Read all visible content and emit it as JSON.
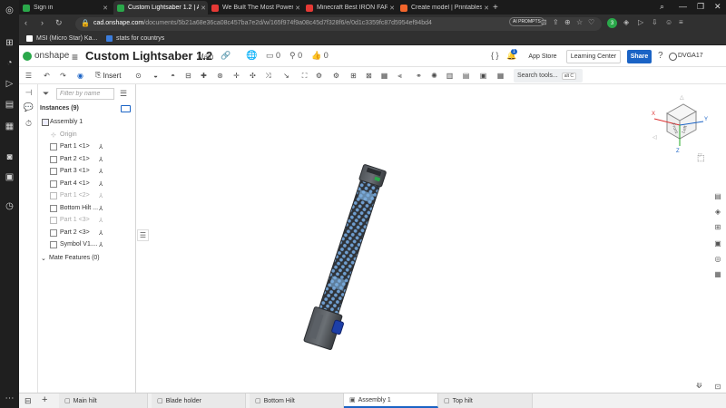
{
  "browser": {
    "tabs": [
      {
        "label": "Sign in",
        "color": "#2aa84a",
        "active": false
      },
      {
        "label": "Custom Lightsaber 1.2 | Ae",
        "color": "#2aa84a",
        "active": true
      },
      {
        "label": "We Built The Most Powerfu",
        "color": "#e53935",
        "active": false
      },
      {
        "label": "Minecraft Best IRON FARM",
        "color": "#e53935",
        "active": false
      },
      {
        "label": "Create model | Printables.c",
        "color": "#f2652b",
        "active": false
      }
    ],
    "new_tab": "+",
    "url_host": "cad.onshape.com",
    "url_path": "/documents/5b21a68e36ca08c457ba7e2d/w/165f974f9a08c45d7f328f6/e/0d1c3359fc87d5954ef94bd4",
    "ai_prompts": "AI PROMPTS",
    "profile_badge": "3",
    "bookmarks": [
      {
        "label": "MSI (Micro Star) Ka...",
        "color": "#ffffff"
      },
      {
        "label": "stats for countrys",
        "color": "#3b7ddd"
      }
    ]
  },
  "app": {
    "logo": "onshape",
    "title": "Custom Lightsaber 1.2",
    "branch": "Main",
    "versions_count": "0",
    "branches_count": "0",
    "likes_count": "0",
    "notifications_count": "1",
    "featurescript": "{ }",
    "app_store": "App Store",
    "learning_center": "Learning Center",
    "share": "Share",
    "user": "DVGA17",
    "insert": "Insert",
    "search_tools": "Search tools...",
    "search_shortcut": "alt C"
  },
  "panel": {
    "filter_placeholder": "Filter by name",
    "instances_header": "Instances (9)",
    "assembly": "Assembly 1",
    "origin": "Origin",
    "items": [
      {
        "label": "Part 1 <1>",
        "dim": false
      },
      {
        "label": "Part 2 <1>",
        "dim": false
      },
      {
        "label": "Part 3 <1>",
        "dim": false
      },
      {
        "label": "Part 4 <1>",
        "dim": false
      },
      {
        "label": "Part 1 <2>",
        "dim": true
      },
      {
        "label": "Bottom Hilt ...",
        "dim": false
      },
      {
        "label": "Part 1 <3>",
        "dim": true
      },
      {
        "label": "Part 2 <3>",
        "dim": false
      },
      {
        "label": "Symbol V1....",
        "dim": false
      }
    ],
    "mate_features": "Mate Features (0)"
  },
  "viewcube": {
    "front": "Front",
    "left": "Left",
    "x": "X",
    "y": "Y",
    "z": "Z"
  },
  "bottom_tabs": [
    {
      "label": "Main hilt",
      "active": false
    },
    {
      "label": "Blade holder",
      "active": false
    },
    {
      "label": "Bottom Hilt",
      "active": false
    },
    {
      "label": "Assembly 1",
      "active": true
    },
    {
      "label": "Top hilt",
      "active": false
    }
  ],
  "colors": {
    "accent": "#1a63c5",
    "onshape_green": "#2aa84a",
    "model_blue": "#4a7bb0",
    "model_dark": "#3e4247"
  }
}
